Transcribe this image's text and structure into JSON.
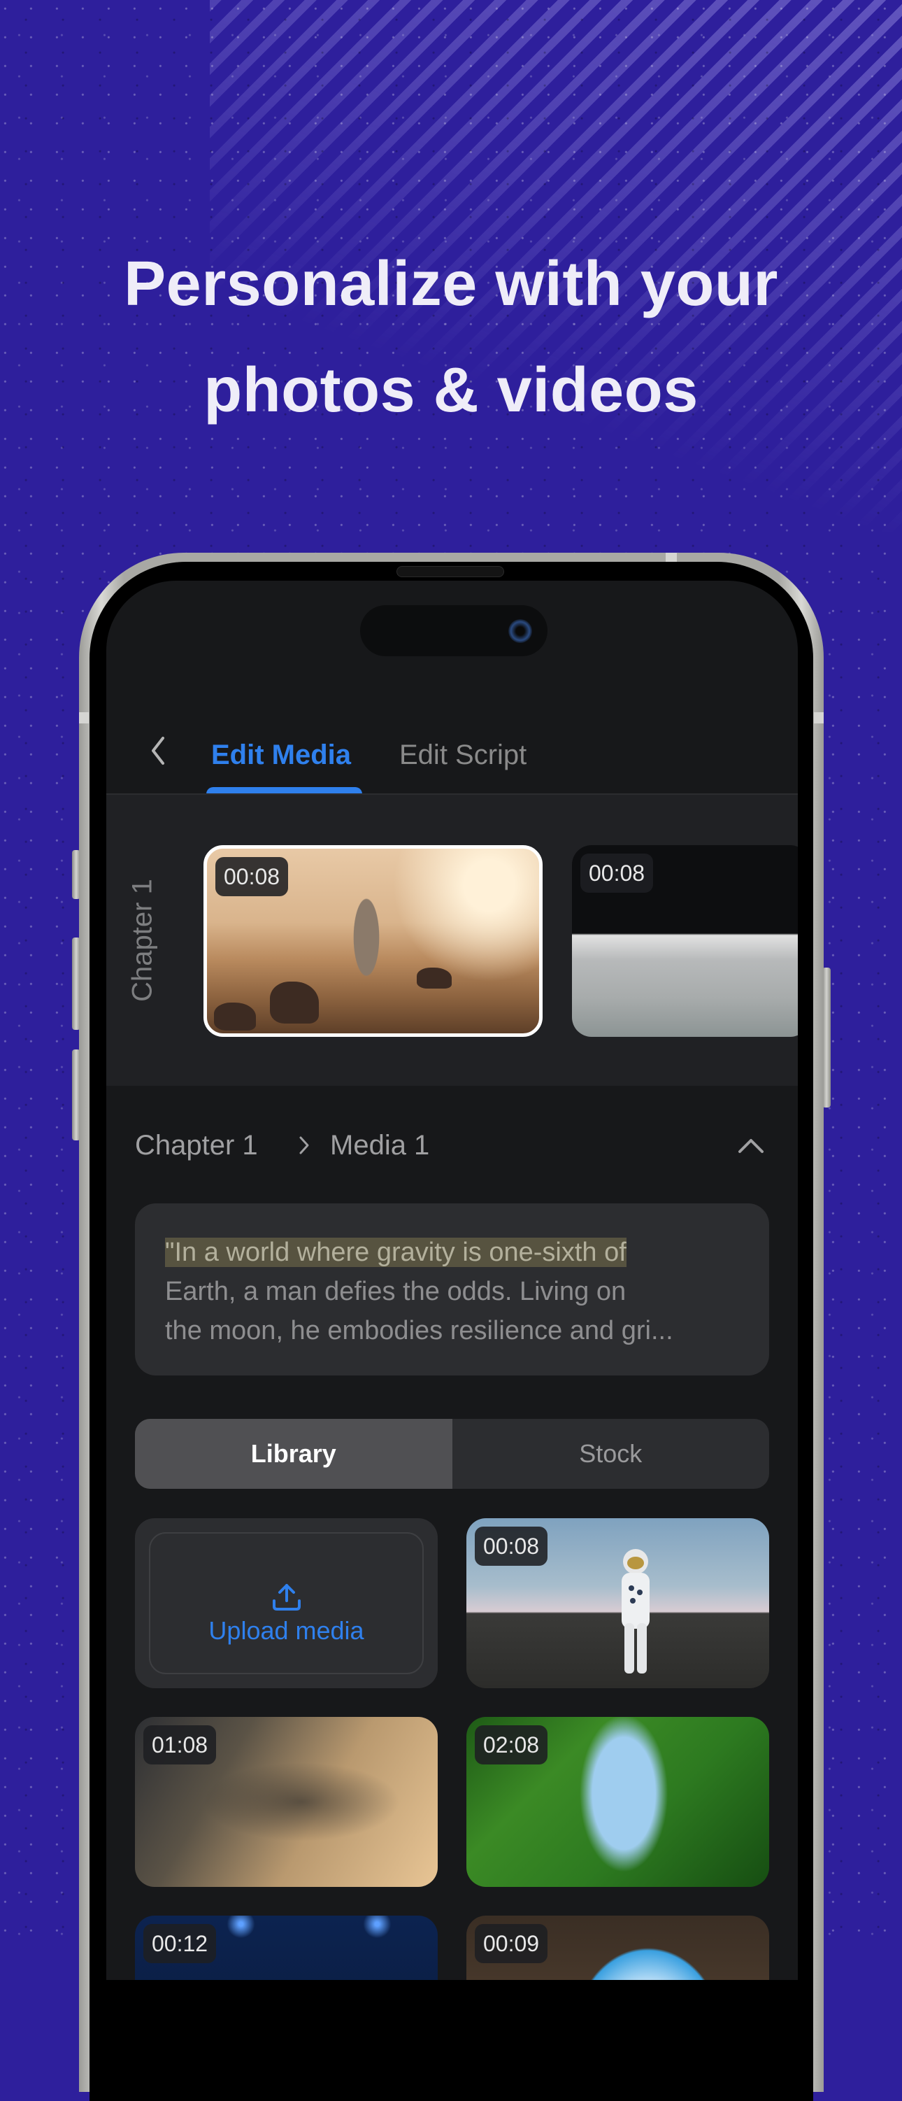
{
  "headline": {
    "line1": "Personalize with your",
    "line2": "photos & videos"
  },
  "colors": {
    "background": "#2e1f9c",
    "accent": "#2f80ed",
    "screen_bg": "#17181a",
    "highlight": "#575340"
  },
  "nav": {
    "back_icon": "chevron-left-icon",
    "tabs": [
      {
        "label": "Edit Media",
        "active": true
      },
      {
        "label": "Edit Script",
        "active": false
      }
    ]
  },
  "chapter_strip": {
    "chapter_label": "Chapter 1",
    "clips": [
      {
        "duration": "00:08",
        "selected": true,
        "scene": "astronaut on mars"
      },
      {
        "duration": "00:08",
        "selected": false,
        "scene": "lunar surface"
      }
    ]
  },
  "breadcrumb": {
    "items": [
      "Chapter 1",
      "Media 1"
    ],
    "separator_icon": "chevron-right-icon",
    "collapse_icon": "chevron-up-icon"
  },
  "script": {
    "highlighted": "\"In a world where gravity is one-sixth of",
    "line2": "Earth, a man defies the odds. Living on",
    "line3": "the moon, he embodies resilience and gri..."
  },
  "source_tabs": {
    "options": [
      {
        "label": "Library",
        "active": true
      },
      {
        "label": "Stock",
        "active": false
      }
    ]
  },
  "library": {
    "upload_label": "Upload media",
    "upload_icon": "upload-icon",
    "items": [
      {
        "duration": "00:08",
        "scene": "astronaut standing in field"
      },
      {
        "duration": "01:08",
        "scene": "dust and stars"
      },
      {
        "duration": "02:08",
        "scene": "forest canopy"
      },
      {
        "duration": "00:12",
        "scene": "stage lights"
      },
      {
        "duration": "00:09",
        "scene": "tunnel to sky"
      }
    ]
  }
}
